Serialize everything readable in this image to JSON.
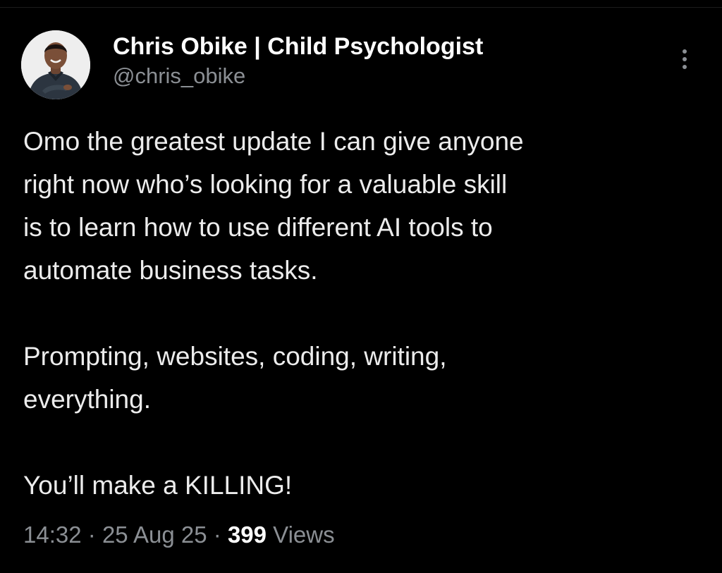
{
  "author": {
    "display_name": "Chris Obike | Child Psychologist",
    "handle": "@chris_obike",
    "avatar_icon": "profile-photo"
  },
  "tweet": {
    "paragraphs": [
      [
        "Omo the greatest update I can give anyone",
        "right now who’s looking for a valuable skill",
        "is to learn how to use different AI tools to",
        "automate business tasks."
      ],
      [
        "Prompting, websites, coding, writing,",
        "everything."
      ],
      [
        "You’ll make a KILLING!"
      ]
    ]
  },
  "meta": {
    "time": "14:32",
    "separator": "·",
    "date": "25 Aug 25",
    "views_count": "399",
    "views_label": "Views"
  },
  "menu": {
    "icon": "more-vertical-icon"
  },
  "colors": {
    "background": "#000000",
    "primary_text": "#e7e9ea",
    "secondary_text": "#8b8f94"
  }
}
